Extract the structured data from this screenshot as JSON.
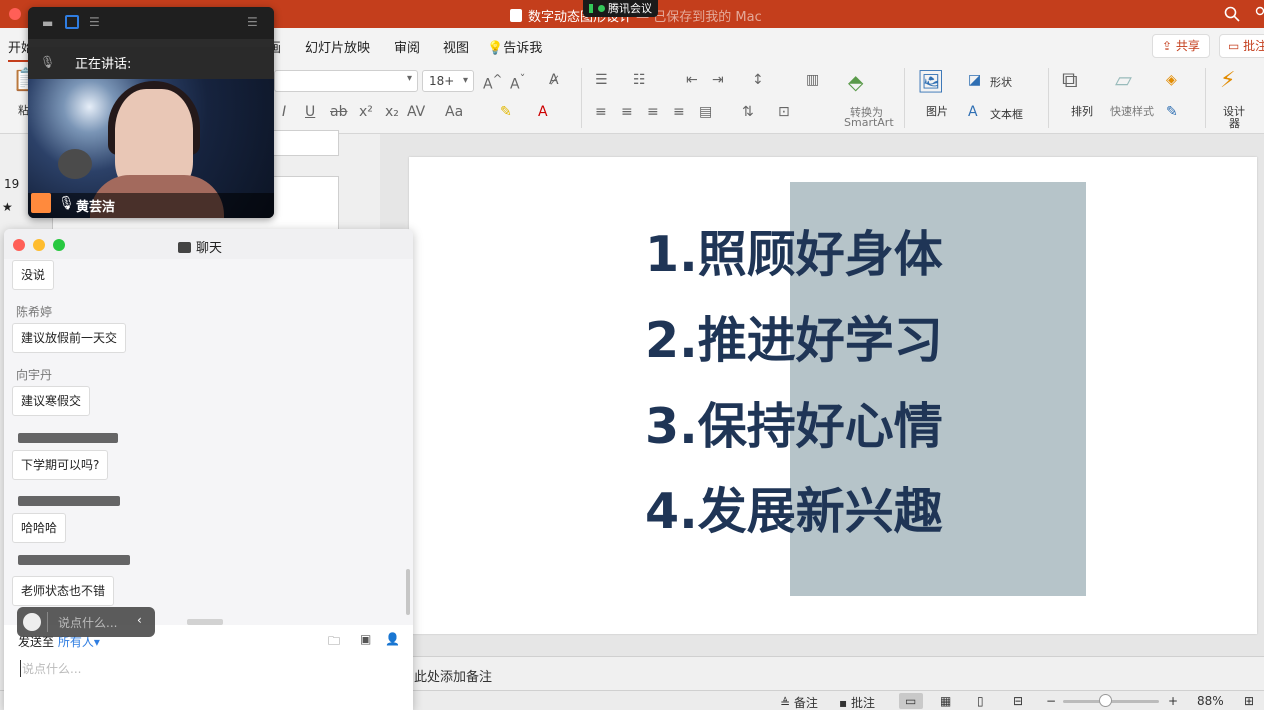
{
  "titlebar": {
    "document_title": "数字动态图形设计",
    "document_title_suffix": " — 已保存到我的 Mac",
    "meeting_app": "腾讯会议"
  },
  "ribbon": {
    "tabs": [
      {
        "label": "开始",
        "active": true
      },
      {
        "label": "画"
      },
      {
        "label": "幻灯片放映"
      },
      {
        "label": "审阅"
      },
      {
        "label": "视图"
      },
      {
        "label": "告诉我"
      }
    ],
    "share_label": "共享",
    "comment_label": "批注",
    "font_size": "18+",
    "paste_label": "粘",
    "smartart_label_1": "转换为",
    "smartart_label_2": "SmartArt",
    "picture_label": "图片",
    "shape_label": "形状",
    "textbox_label": "文本框",
    "arrange_label": "排列",
    "quickstyle_label": "快速样式",
    "design_label_1": "设计",
    "design_label_2": "器"
  },
  "slide_pane": {
    "slide_number": "19",
    "star": "★"
  },
  "slide": {
    "points": [
      "1.照顾好身体",
      "2.推进好学习",
      "3.保持好心情",
      "4.发展新兴趣"
    ],
    "text_color": "#1f3556",
    "block_color": "#b6c4c9"
  },
  "notes": {
    "placeholder": "此处添加备注"
  },
  "statusbar": {
    "notes_label": "备注",
    "comments_label": "批注",
    "zoom": "88%"
  },
  "video": {
    "speaking_label": "正在讲话:",
    "speaker_name": "黄芸洁"
  },
  "chat": {
    "title": "聊天",
    "messages": [
      {
        "sender": "",
        "text": "没说"
      },
      {
        "sender": "陈希婷",
        "text": "建议放假前一天交"
      },
      {
        "sender": "向宇丹",
        "text": "建议寒假交"
      },
      {
        "sender": "",
        "text": "下学期可以吗?"
      },
      {
        "sender": "",
        "text": "哈哈哈"
      },
      {
        "sender": "",
        "text": "老师状态也不错"
      }
    ],
    "send_to_label": "发送至",
    "recipient": "所有人",
    "input_placeholder": "说点什么...",
    "float_placeholder": "说点什么..."
  }
}
